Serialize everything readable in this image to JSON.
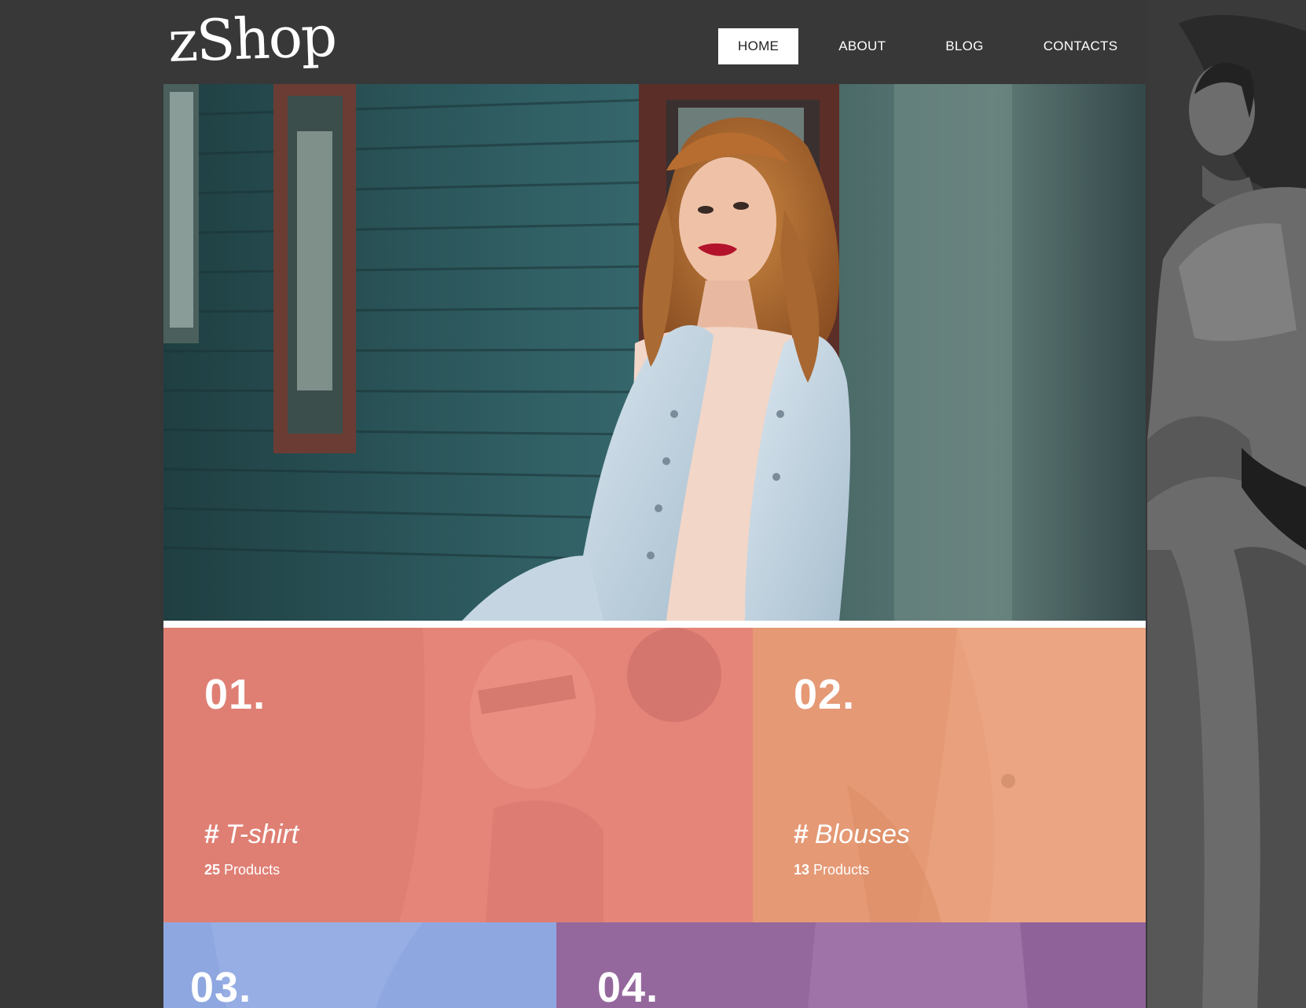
{
  "header": {
    "logo": "zShop",
    "nav": [
      {
        "label": "HOME",
        "active": true
      },
      {
        "label": "ABOUT",
        "active": false
      },
      {
        "label": "BLOG",
        "active": false
      },
      {
        "label": "CONTACTS",
        "active": false
      }
    ]
  },
  "categories": [
    {
      "number": "01.",
      "hash": "#",
      "title": "T-shirt",
      "count": "25",
      "count_label": "Products",
      "color": "#df7f74"
    },
    {
      "number": "02.",
      "hash": "#",
      "title": "Blouses",
      "count": "13",
      "count_label": "Products",
      "color": "#e9a17d"
    },
    {
      "number": "03.",
      "color": "#8fa7e0"
    },
    {
      "number": "04.",
      "color": "#95689d"
    }
  ],
  "colors": {
    "page_background": "#383838",
    "nav_active_background": "#ffffff"
  }
}
